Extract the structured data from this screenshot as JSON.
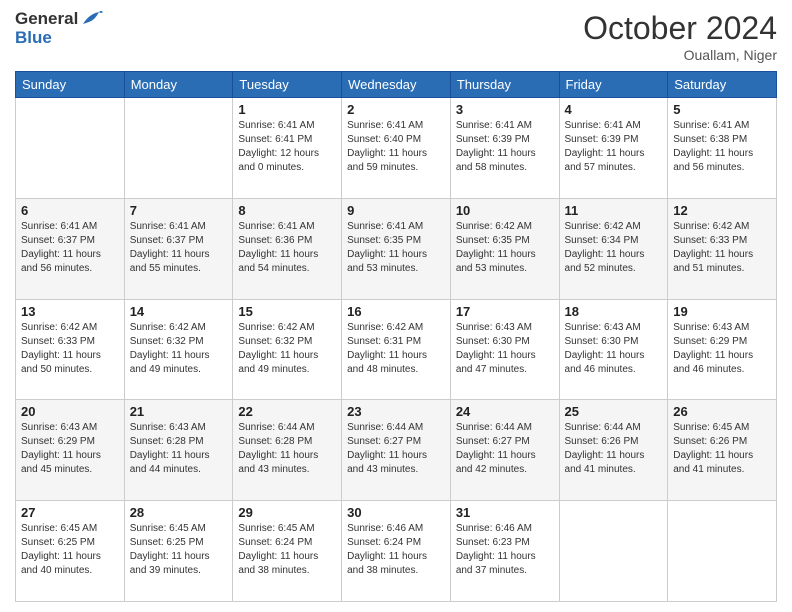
{
  "header": {
    "logo_general": "General",
    "logo_blue": "Blue",
    "month_title": "October 2024",
    "location": "Ouallam, Niger"
  },
  "weekdays": [
    "Sunday",
    "Monday",
    "Tuesday",
    "Wednesday",
    "Thursday",
    "Friday",
    "Saturday"
  ],
  "weeks": [
    [
      {
        "day": "",
        "info": ""
      },
      {
        "day": "",
        "info": ""
      },
      {
        "day": "1",
        "info": "Sunrise: 6:41 AM\nSunset: 6:41 PM\nDaylight: 12 hours and 0 minutes."
      },
      {
        "day": "2",
        "info": "Sunrise: 6:41 AM\nSunset: 6:40 PM\nDaylight: 11 hours and 59 minutes."
      },
      {
        "day": "3",
        "info": "Sunrise: 6:41 AM\nSunset: 6:39 PM\nDaylight: 11 hours and 58 minutes."
      },
      {
        "day": "4",
        "info": "Sunrise: 6:41 AM\nSunset: 6:39 PM\nDaylight: 11 hours and 57 minutes."
      },
      {
        "day": "5",
        "info": "Sunrise: 6:41 AM\nSunset: 6:38 PM\nDaylight: 11 hours and 56 minutes."
      }
    ],
    [
      {
        "day": "6",
        "info": "Sunrise: 6:41 AM\nSunset: 6:37 PM\nDaylight: 11 hours and 56 minutes."
      },
      {
        "day": "7",
        "info": "Sunrise: 6:41 AM\nSunset: 6:37 PM\nDaylight: 11 hours and 55 minutes."
      },
      {
        "day": "8",
        "info": "Sunrise: 6:41 AM\nSunset: 6:36 PM\nDaylight: 11 hours and 54 minutes."
      },
      {
        "day": "9",
        "info": "Sunrise: 6:41 AM\nSunset: 6:35 PM\nDaylight: 11 hours and 53 minutes."
      },
      {
        "day": "10",
        "info": "Sunrise: 6:42 AM\nSunset: 6:35 PM\nDaylight: 11 hours and 53 minutes."
      },
      {
        "day": "11",
        "info": "Sunrise: 6:42 AM\nSunset: 6:34 PM\nDaylight: 11 hours and 52 minutes."
      },
      {
        "day": "12",
        "info": "Sunrise: 6:42 AM\nSunset: 6:33 PM\nDaylight: 11 hours and 51 minutes."
      }
    ],
    [
      {
        "day": "13",
        "info": "Sunrise: 6:42 AM\nSunset: 6:33 PM\nDaylight: 11 hours and 50 minutes."
      },
      {
        "day": "14",
        "info": "Sunrise: 6:42 AM\nSunset: 6:32 PM\nDaylight: 11 hours and 49 minutes."
      },
      {
        "day": "15",
        "info": "Sunrise: 6:42 AM\nSunset: 6:32 PM\nDaylight: 11 hours and 49 minutes."
      },
      {
        "day": "16",
        "info": "Sunrise: 6:42 AM\nSunset: 6:31 PM\nDaylight: 11 hours and 48 minutes."
      },
      {
        "day": "17",
        "info": "Sunrise: 6:43 AM\nSunset: 6:30 PM\nDaylight: 11 hours and 47 minutes."
      },
      {
        "day": "18",
        "info": "Sunrise: 6:43 AM\nSunset: 6:30 PM\nDaylight: 11 hours and 46 minutes."
      },
      {
        "day": "19",
        "info": "Sunrise: 6:43 AM\nSunset: 6:29 PM\nDaylight: 11 hours and 46 minutes."
      }
    ],
    [
      {
        "day": "20",
        "info": "Sunrise: 6:43 AM\nSunset: 6:29 PM\nDaylight: 11 hours and 45 minutes."
      },
      {
        "day": "21",
        "info": "Sunrise: 6:43 AM\nSunset: 6:28 PM\nDaylight: 11 hours and 44 minutes."
      },
      {
        "day": "22",
        "info": "Sunrise: 6:44 AM\nSunset: 6:28 PM\nDaylight: 11 hours and 43 minutes."
      },
      {
        "day": "23",
        "info": "Sunrise: 6:44 AM\nSunset: 6:27 PM\nDaylight: 11 hours and 43 minutes."
      },
      {
        "day": "24",
        "info": "Sunrise: 6:44 AM\nSunset: 6:27 PM\nDaylight: 11 hours and 42 minutes."
      },
      {
        "day": "25",
        "info": "Sunrise: 6:44 AM\nSunset: 6:26 PM\nDaylight: 11 hours and 41 minutes."
      },
      {
        "day": "26",
        "info": "Sunrise: 6:45 AM\nSunset: 6:26 PM\nDaylight: 11 hours and 41 minutes."
      }
    ],
    [
      {
        "day": "27",
        "info": "Sunrise: 6:45 AM\nSunset: 6:25 PM\nDaylight: 11 hours and 40 minutes."
      },
      {
        "day": "28",
        "info": "Sunrise: 6:45 AM\nSunset: 6:25 PM\nDaylight: 11 hours and 39 minutes."
      },
      {
        "day": "29",
        "info": "Sunrise: 6:45 AM\nSunset: 6:24 PM\nDaylight: 11 hours and 38 minutes."
      },
      {
        "day": "30",
        "info": "Sunrise: 6:46 AM\nSunset: 6:24 PM\nDaylight: 11 hours and 38 minutes."
      },
      {
        "day": "31",
        "info": "Sunrise: 6:46 AM\nSunset: 6:23 PM\nDaylight: 11 hours and 37 minutes."
      },
      {
        "day": "",
        "info": ""
      },
      {
        "day": "",
        "info": ""
      }
    ]
  ]
}
